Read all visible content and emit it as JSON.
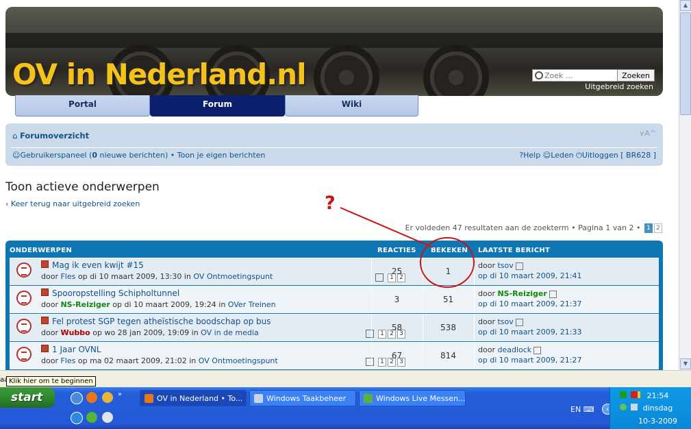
{
  "site": {
    "logo_text": "OV in Nederland.nl",
    "search_placeholder": "Zoek ...",
    "search_button": "Zoeken",
    "advanced_search": "Uitgebreid zoeken"
  },
  "tabs": [
    {
      "label": "Portal",
      "active": false
    },
    {
      "label": "Forum",
      "active": true
    },
    {
      "label": "Wiki",
      "active": false
    }
  ],
  "navbar": {
    "breadcrumb": "Forumoverzicht",
    "font_resize": "A",
    "user_panel": "Gebruikerspaneel",
    "new_messages_prefix": "(",
    "new_messages_count": "0",
    "new_messages_suffix": "nieuwe berichten)",
    "bullet": "•",
    "own_posts": "Toon je eigen berichten",
    "help": "Help",
    "members": "Leden",
    "logout": "Uitloggen [ BR628 ]"
  },
  "page": {
    "title": "Toon actieve onderwerpen",
    "back_link": "Keer terug naar uitgebreid zoeken",
    "results_text": "Er voldeden 47 resultaten aan de zoekterm",
    "page_label": "Pagina",
    "page_current": "1",
    "page_of": "van",
    "page_total": "2",
    "pages": [
      "1",
      "2"
    ]
  },
  "annotation": {
    "question_mark": "?",
    "color": "#cc1111"
  },
  "table": {
    "headers": {
      "topics": "ONDERWERPEN",
      "replies": "REACTIES",
      "views": "BEKEKEN",
      "last_post": "LAATSTE BERICHT"
    },
    "rows": [
      {
        "title": "Mag ik even kwijt #15",
        "by_label": "door",
        "author": "Fles",
        "date_text": "op di 10 maart 2009, 13:30",
        "in_label": "in",
        "forum": "OV Ontmoetingspunt",
        "pages": [
          "1",
          "2"
        ],
        "replies": "25",
        "views": "1",
        "last_by_label": "door",
        "last_author": "tsov",
        "last_date": "op di 10 maart 2009, 21:41"
      },
      {
        "title": "Spooropstelling Schipholtunnel",
        "by_label": "door",
        "author": "NS-Reiziger",
        "date_text": "op di 10 maart 2009, 19:24",
        "in_label": "in",
        "forum": "OVer Treinen",
        "pages": [],
        "replies": "3",
        "views": "51",
        "last_by_label": "door",
        "last_author": "NS-Reiziger",
        "last_date": "op di 10 maart 2009, 21:37"
      },
      {
        "title": "Fel protest SGP tegen atheïstische boodschap op bus",
        "by_label": "door",
        "author": "Wubbo",
        "date_text": "op wo 28 jan 2009, 19:09",
        "in_label": "in",
        "forum": "OV in de media",
        "pages": [
          "1",
          "2",
          "3"
        ],
        "replies": "58",
        "views": "538",
        "last_by_label": "door",
        "last_author": "tsov",
        "last_date": "op di 10 maart 2009, 21:33"
      },
      {
        "title": "1 Jaar OVNL",
        "by_label": "door",
        "author": "Fles",
        "date_text": "op ma 02 maart 2009, 21:02",
        "in_label": "in",
        "forum": "OV Ontmoetingspunt",
        "pages": [
          "1",
          "2",
          "3"
        ],
        "replies": "67",
        "views": "814",
        "last_by_label": "door",
        "last_author": "deadlock",
        "last_date": "op di 10 maart 2009, 21:27"
      }
    ]
  },
  "taskbar": {
    "start_label": "start",
    "tooltip": "Klik hier om te beginnen",
    "tooltip_prefix": "aa",
    "buttons": [
      {
        "label": "OV in Nederland • To...",
        "active": true
      },
      {
        "label": "Windows Taakbeheer",
        "active": false
      },
      {
        "label": "Windows Live Messen...",
        "active": false
      }
    ],
    "language": "EN",
    "time": "21:54",
    "day": "dinsdag",
    "date": "10-3-2009"
  },
  "colors": {
    "link": "#105289",
    "forum_header": "#0f76b4",
    "logo": "#f4c21b",
    "taskbar": "#245edb"
  }
}
